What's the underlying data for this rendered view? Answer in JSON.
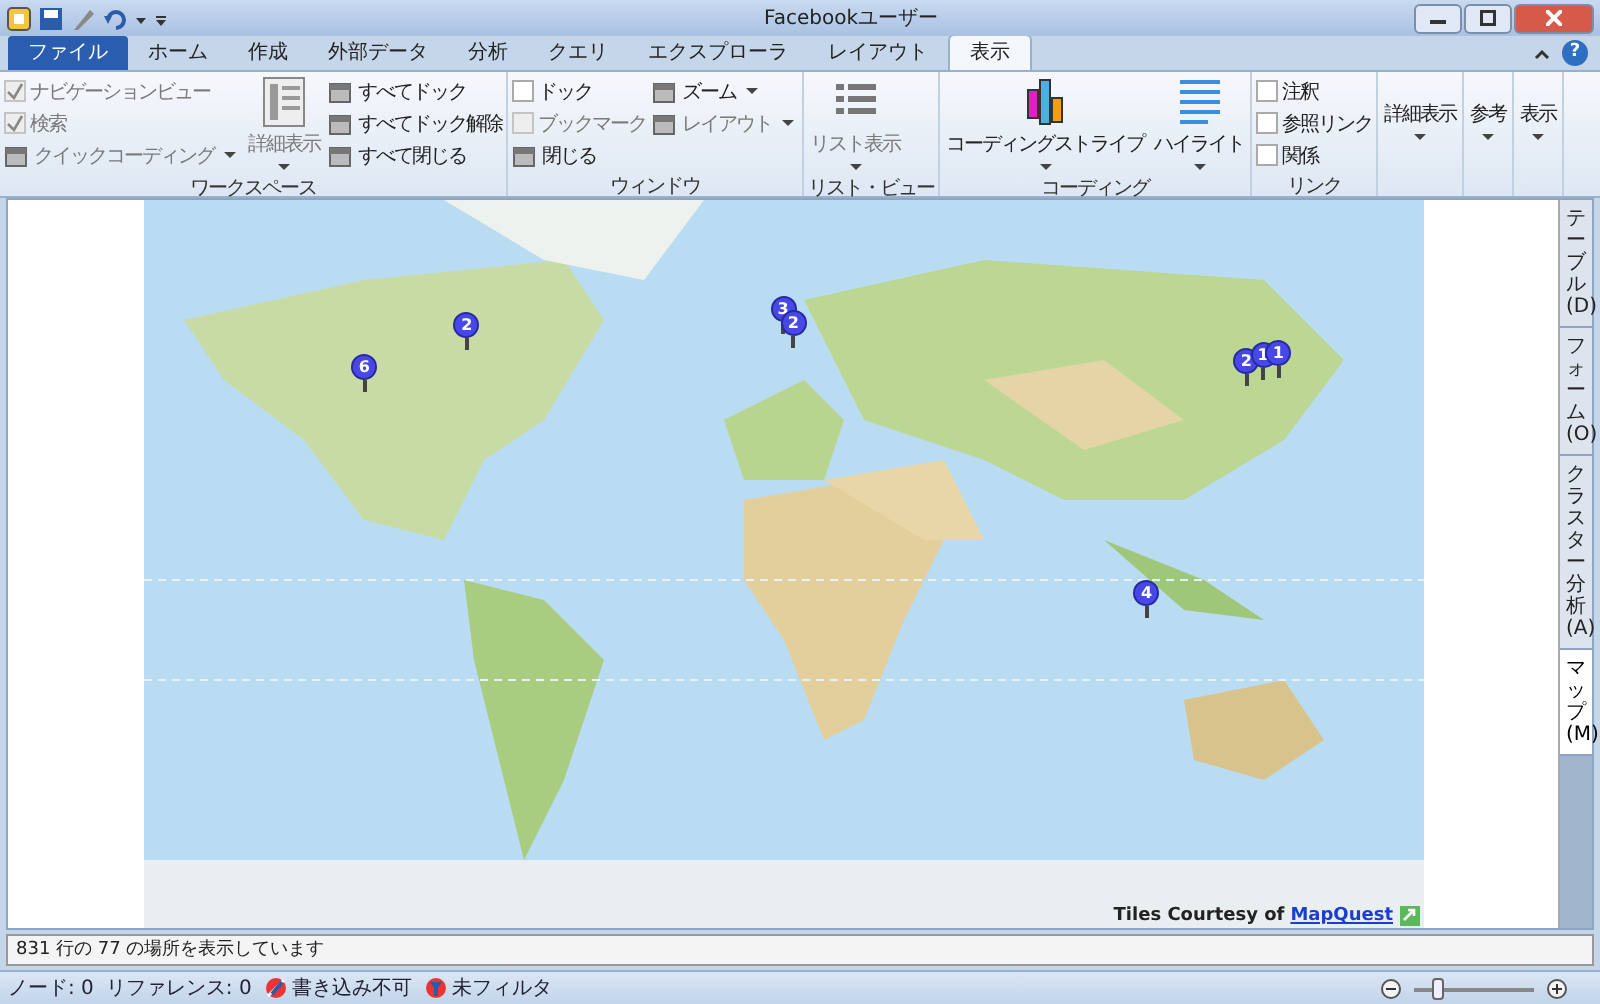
{
  "window": {
    "title": "Facebookユーザー"
  },
  "help": "?",
  "tabs": [
    {
      "label": "ファイル",
      "kind": "file",
      "selected": false
    },
    {
      "label": "ホーム",
      "kind": "tab",
      "selected": false
    },
    {
      "label": "作成",
      "kind": "tab",
      "selected": false
    },
    {
      "label": "外部データ",
      "kind": "tab",
      "selected": false
    },
    {
      "label": "分析",
      "kind": "tab",
      "selected": false
    },
    {
      "label": "クエリ",
      "kind": "tab",
      "selected": false
    },
    {
      "label": "エクスプローラ",
      "kind": "tab",
      "selected": false
    },
    {
      "label": "レイアウト",
      "kind": "tab",
      "selected": false
    },
    {
      "label": "表示",
      "kind": "tab",
      "selected": true
    }
  ],
  "ribbon": [
    {
      "label": "ワークスペース",
      "columns": [
        [
          {
            "kind": "check",
            "label": "ナビゲーションビュー",
            "checked": true,
            "disabled": true
          },
          {
            "kind": "check",
            "label": "検索",
            "checked": true,
            "disabled": true
          },
          {
            "kind": "small",
            "label": "クイックコーディング",
            "dropdown": true,
            "disabled": true
          }
        ],
        [
          {
            "kind": "large",
            "label": "詳細表示",
            "dropdown": true,
            "disabled": true
          }
        ],
        [
          {
            "kind": "small",
            "label": "すべてドック",
            "disabled": false
          },
          {
            "kind": "small",
            "label": "すべてドック解除",
            "disabled": false
          },
          {
            "kind": "small",
            "label": "すべて閉じる",
            "disabled": false
          }
        ]
      ]
    },
    {
      "label": "ウィンドウ",
      "columns": [
        [
          {
            "kind": "check",
            "label": "ドック",
            "checked": false,
            "disabled": false
          },
          {
            "kind": "check",
            "label": "ブックマーク",
            "checked": false,
            "disabled": true
          },
          {
            "kind": "small",
            "label": "閉じる",
            "disabled": false
          }
        ],
        [
          {
            "kind": "small",
            "label": "ズーム",
            "dropdown": true,
            "disabled": false
          },
          {
            "kind": "small",
            "label": "レイアウト",
            "dropdown": true,
            "disabled": true
          }
        ]
      ]
    },
    {
      "label": "リスト・ビュー",
      "columns": [
        [
          {
            "kind": "large",
            "label": "リスト表示",
            "dropdown": true,
            "disabled": true
          }
        ]
      ]
    },
    {
      "label": "コーディング",
      "columns": [
        [
          {
            "kind": "large",
            "label": "コーディングストライプ",
            "dropdown": true,
            "disabled": false
          }
        ],
        [
          {
            "kind": "large",
            "label": "ハイライト",
            "dropdown": true,
            "disabled": false
          }
        ]
      ]
    },
    {
      "label": "リンク",
      "columns": [
        [
          {
            "kind": "check",
            "label": "注釈",
            "checked": false,
            "disabled": false
          },
          {
            "kind": "check",
            "label": "参照リンク",
            "checked": false,
            "disabled": false
          },
          {
            "kind": "check",
            "label": "関係",
            "checked": false,
            "disabled": false
          }
        ]
      ]
    },
    {
      "columns": [
        [
          {
            "kind": "menu",
            "label": "詳細表示",
            "dropdown": true,
            "disabled": false
          }
        ]
      ]
    },
    {
      "columns": [
        [
          {
            "kind": "menu",
            "label": "参考",
            "dropdown": true,
            "disabled": false
          }
        ]
      ]
    },
    {
      "columns": [
        [
          {
            "kind": "menu",
            "label": "表示",
            "dropdown": true,
            "disabled": false
          }
        ]
      ]
    }
  ],
  "map": {
    "pins": [
      {
        "count": "2"
      },
      {
        "count": "6"
      },
      {
        "count": "3"
      },
      {
        "count": "2"
      },
      {
        "count": "2"
      },
      {
        "count": "1"
      },
      {
        "count": "1"
      },
      {
        "count": "4"
      }
    ],
    "credit": "Tiles Courtesy of",
    "credit_link": "MapQuest"
  },
  "side_tabs": [
    {
      "label": "テーブル(D)",
      "selected": false
    },
    {
      "label": "フォーム(O)",
      "selected": false
    },
    {
      "label": "クラスター分析(A)",
      "selected": false
    },
    {
      "label": "マップ(M)",
      "selected": true
    }
  ],
  "status_line": "831 行の 77 の場所を表示しています",
  "status_bar": {
    "items": [
      {
        "kind": "text",
        "label": "ノード: 0"
      },
      {
        "kind": "text",
        "label": "リファレンス: 0"
      },
      {
        "kind": "locked",
        "label": "書き込み不可"
      },
      {
        "kind": "filter",
        "label": "未フィルタ"
      }
    ],
    "zoom": {
      "level": 0.15
    }
  }
}
